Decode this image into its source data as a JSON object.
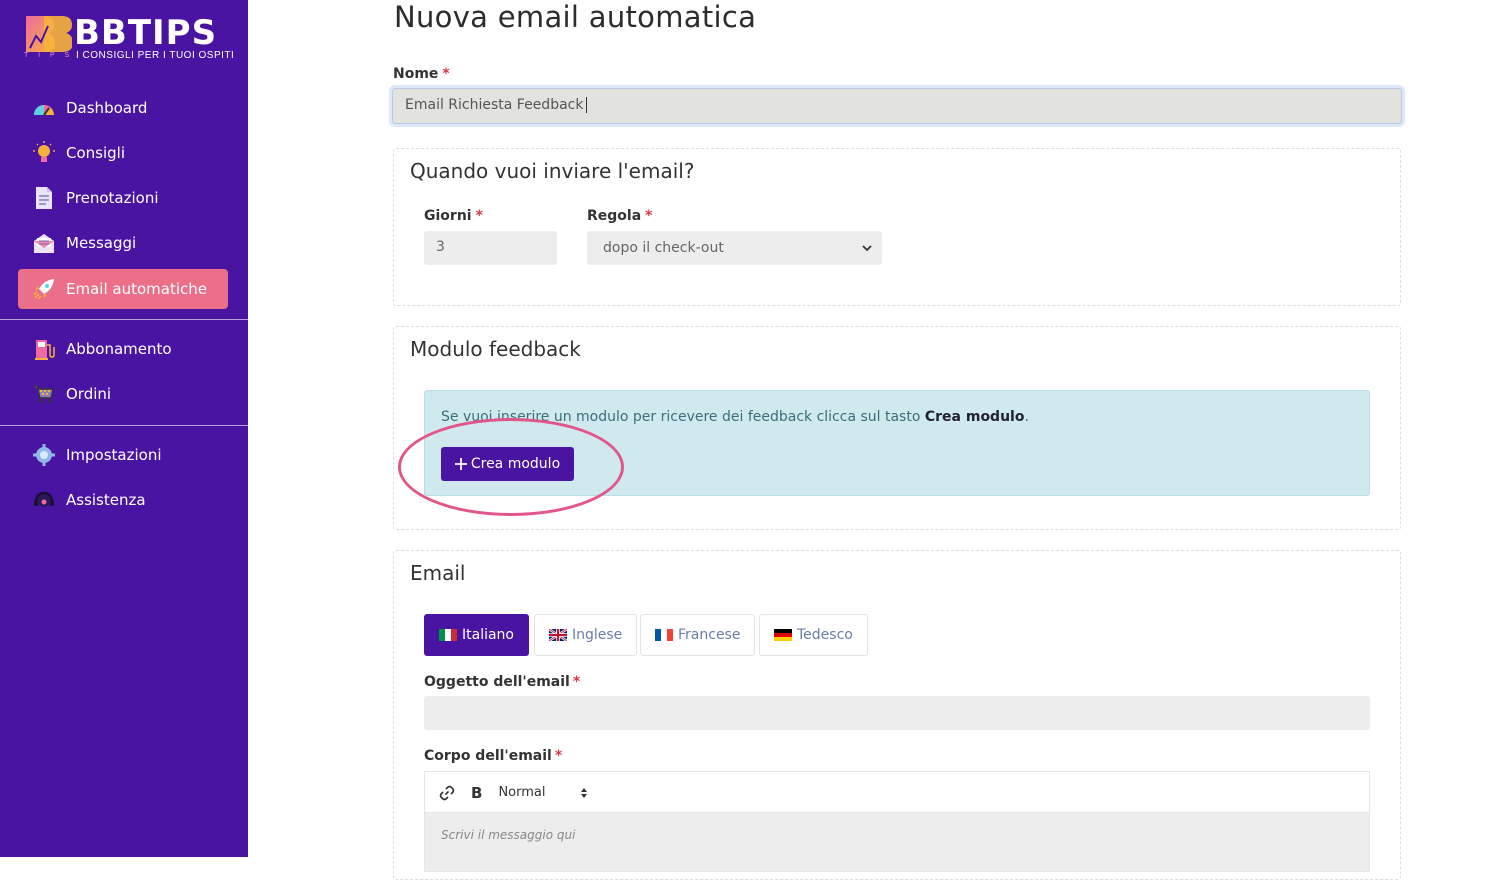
{
  "brand": {
    "name": "BBTIPS",
    "tagline": "I CONSIGLI PER I TUOI OSPITI",
    "tips_letters": "T I P S"
  },
  "sidebar": {
    "items": [
      {
        "label": "Dashboard",
        "icon": "dashboard-icon",
        "active": false
      },
      {
        "label": "Consigli",
        "icon": "lightbulb-icon",
        "active": false
      },
      {
        "label": "Prenotazioni",
        "icon": "document-icon",
        "active": false
      },
      {
        "label": "Messaggi",
        "icon": "envelope-icon",
        "active": false
      },
      {
        "label": "Email automatiche",
        "icon": "rocket-icon",
        "active": true
      },
      {
        "label": "Abbonamento",
        "icon": "gas-pump-icon",
        "active": false
      },
      {
        "label": "Ordini",
        "icon": "cart-icon",
        "active": false
      },
      {
        "label": "Impostazioni",
        "icon": "gear-icon",
        "active": false
      },
      {
        "label": "Assistenza",
        "icon": "headset-icon",
        "active": false
      }
    ]
  },
  "page": {
    "title": "Nuova email automatica"
  },
  "form": {
    "nome_label": "Nome",
    "nome_value": "Email Richiesta Feedback",
    "required_mark": "*",
    "quando": {
      "legend": "Quando vuoi inviare l'email?",
      "giorni_label": "Giorni",
      "giorni_value": "3",
      "regola_label": "Regola",
      "regola_value": "dopo il check-out"
    },
    "modulo": {
      "legend": "Modulo feedback",
      "info_text": "Se vuoi inserire un modulo per ricevere dei feedback clicca sul tasto ",
      "info_bold": "Crea modulo",
      "info_end": ".",
      "button_label": "Crea modulo",
      "button_icon": "plus-icon"
    },
    "email": {
      "legend": "Email",
      "tabs": [
        {
          "label": "Italiano",
          "flag": "it-flag-icon",
          "active": true
        },
        {
          "label": "Inglese",
          "flag": "uk-flag-icon",
          "active": false
        },
        {
          "label": "Francese",
          "flag": "fr-flag-icon",
          "active": false
        },
        {
          "label": "Tedesco",
          "flag": "de-flag-icon",
          "active": false
        }
      ],
      "oggetto_label": "Oggetto dell'email",
      "corpo_label": "Corpo dell'email",
      "toolbar_format": "Normal",
      "body_placeholder": "Scrivi il messaggio qui"
    }
  },
  "colors": {
    "sidebar_bg": "#4a14a3",
    "active_item": "#ec6f8a",
    "primary": "#4a14a3",
    "highlight_ring": "#e2558a",
    "info_bg": "#cfe9ef"
  }
}
